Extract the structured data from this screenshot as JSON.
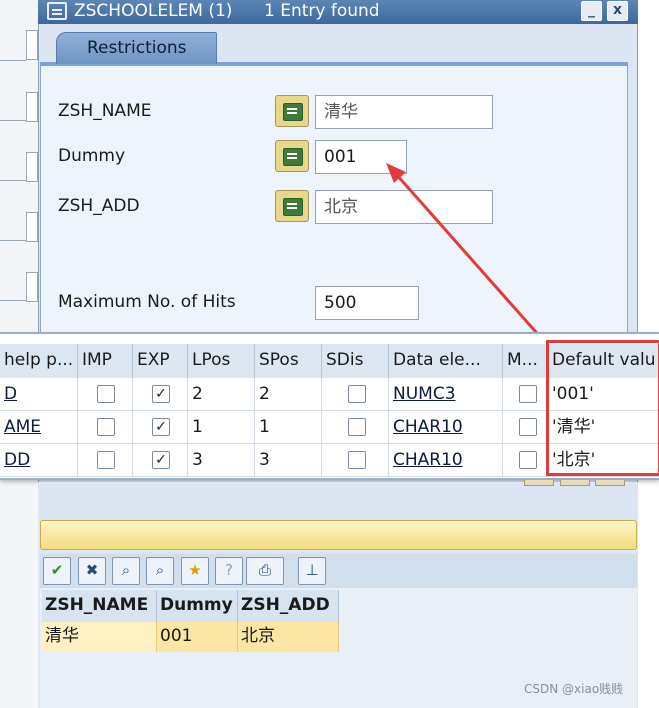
{
  "dialog": {
    "title": "ZSCHOOLELEM (1)",
    "entries_found": "1 Entry found",
    "minimize_glyph": "_",
    "close_glyph": "x"
  },
  "tab": {
    "label": "Restrictions"
  },
  "restrictions": {
    "fields": [
      {
        "label": "ZSH_NAME",
        "value": "清华",
        "operator_icon": "equals-icon"
      },
      {
        "label": "Dummy",
        "value": "001",
        "operator_icon": "equals-icon"
      },
      {
        "label": "ZSH_ADD",
        "value": "北京",
        "operator_icon": "equals-icon"
      }
    ],
    "max_hits_label": "Maximum No. of Hits",
    "max_hits_value": "500"
  },
  "param_table": {
    "headers": [
      "help p...",
      "IMP",
      "EXP",
      "LPos",
      "SPos",
      "SDis",
      "Data ele...",
      "M...",
      "Default valu"
    ],
    "rows": [
      {
        "name": "D",
        "imp": false,
        "exp": true,
        "lpos": "2",
        "spos": "2",
        "sdis": false,
        "data_element": "NUMC3",
        "m": false,
        "default": "'001'"
      },
      {
        "name": "AME",
        "imp": false,
        "exp": true,
        "lpos": "1",
        "spos": "1",
        "sdis": false,
        "data_element": "CHAR10",
        "m": false,
        "default": "'清华'"
      },
      {
        "name": "DD",
        "imp": false,
        "exp": true,
        "lpos": "3",
        "spos": "3",
        "sdis": false,
        "data_element": "CHAR10",
        "m": false,
        "default": "'北京'"
      }
    ],
    "check_glyph": "✓",
    "highlight_color": "#e23b3b"
  },
  "toolbar": {
    "icons": [
      "check-icon",
      "cancel-icon",
      "binoculars-icon",
      "find-next-icon",
      "new-favorite-icon",
      "help-icon",
      "print-icon",
      "pin-icon"
    ],
    "glyphs": [
      "✔",
      "✖",
      "⌕",
      "⌕",
      "★",
      "?",
      "⎙",
      "⊥"
    ]
  },
  "results": {
    "headers": [
      "ZSH_NAME",
      "Dummy",
      "ZSH_ADD"
    ],
    "row": [
      "清华",
      "001",
      "北京"
    ]
  },
  "watermark": "CSDN @xiao贱贱"
}
